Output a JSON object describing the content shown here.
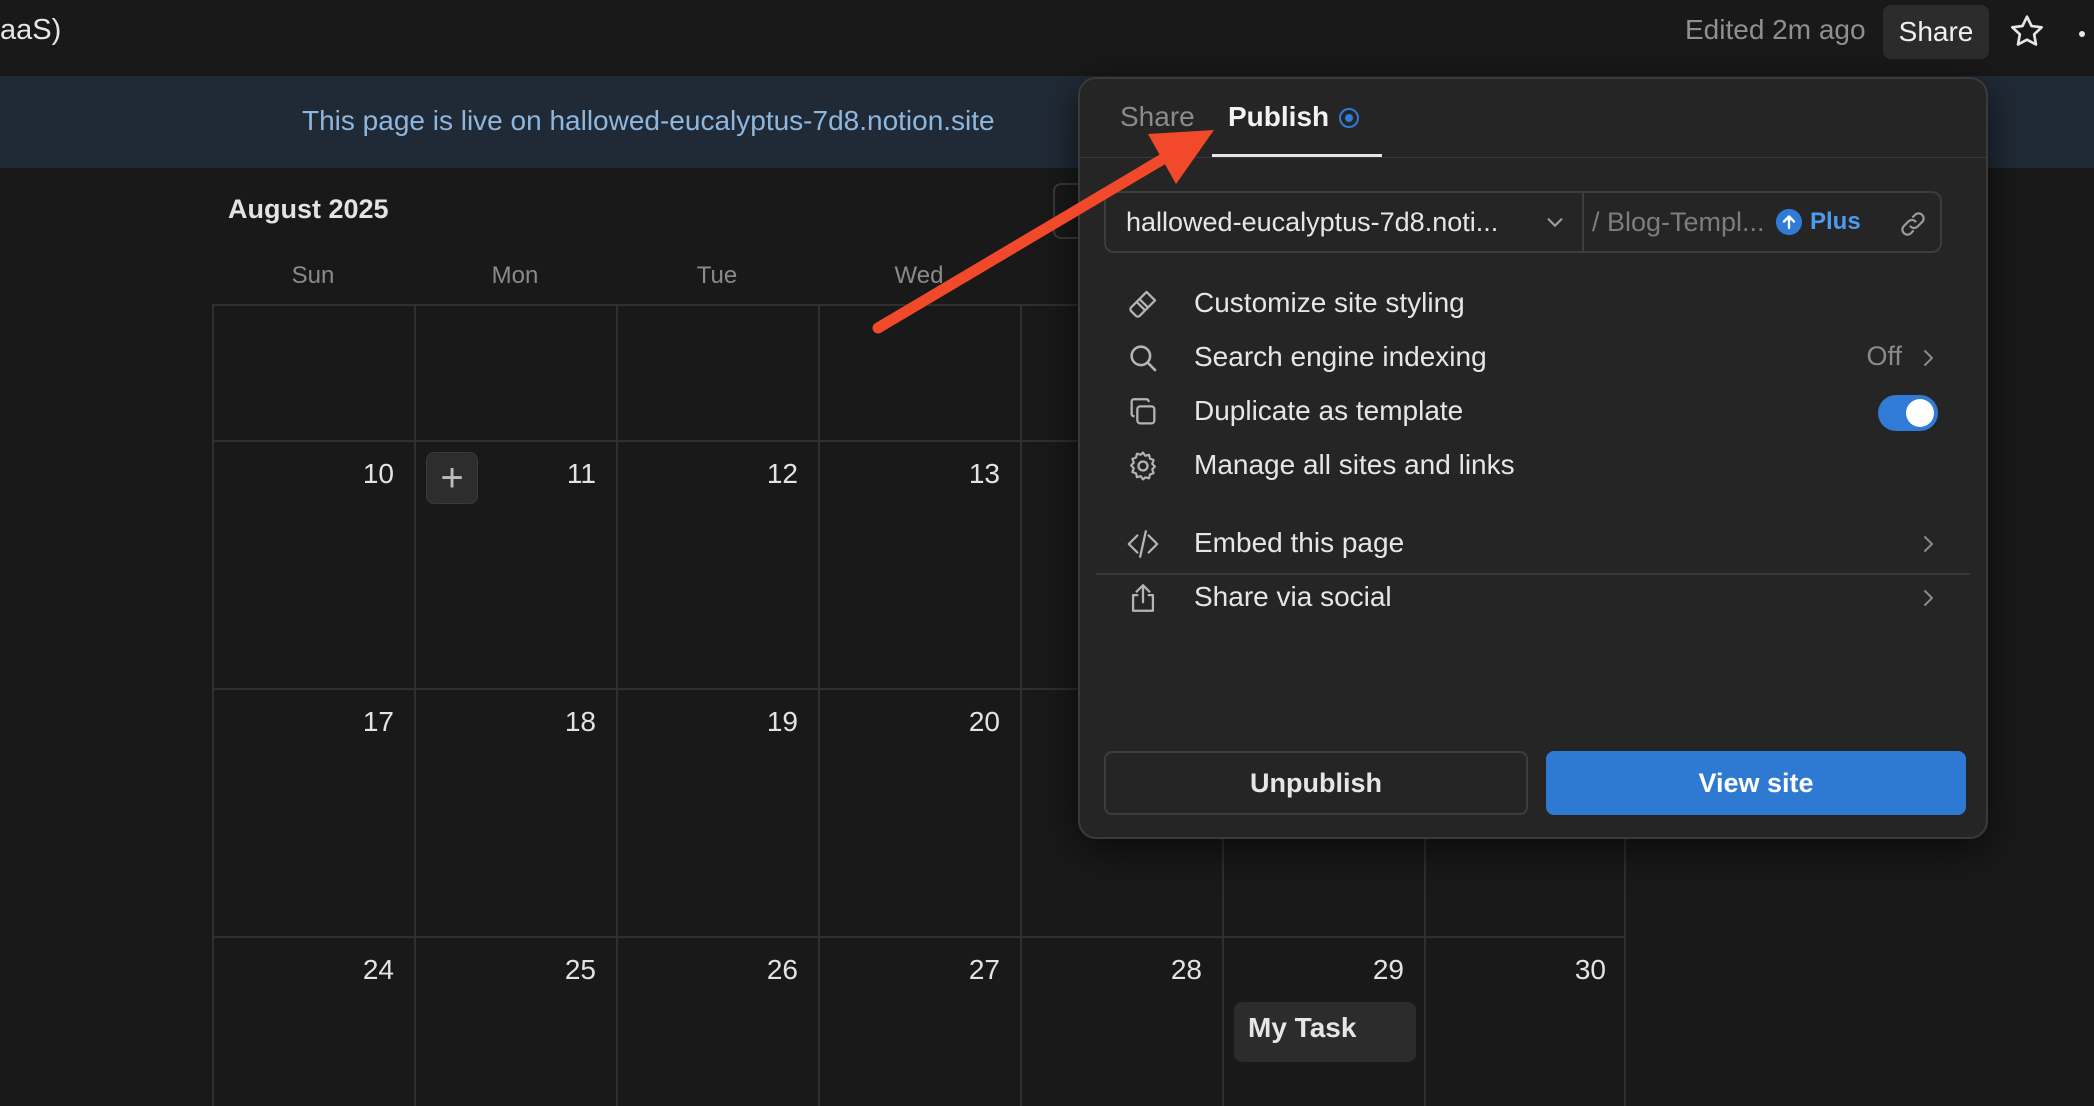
{
  "topbar": {
    "page_title": "aaS)",
    "edited_label": "Edited 2m ago",
    "share_label": "Share",
    "star_icon": "star-icon",
    "more_icon": "more-horizontal-icon"
  },
  "banner": {
    "text": "This page is live on hallowed-eucalyptus-7d8.notion.site"
  },
  "calendar": {
    "month": "August 2025",
    "weekdays": [
      "Sun",
      "Mon",
      "Tue",
      "Wed"
    ],
    "weeks": [
      [
        "",
        "",
        "",
        "",
        "",
        "",
        ""
      ],
      [
        "10",
        "11",
        "12",
        "13",
        "",
        "",
        ""
      ],
      [
        "17",
        "18",
        "19",
        "20",
        "",
        "",
        ""
      ],
      [
        "24",
        "25",
        "26",
        "27",
        "28",
        "29",
        "30"
      ]
    ],
    "add_icon": "plus-icon",
    "task_label": "My Task"
  },
  "popover": {
    "tabs": {
      "share": "Share",
      "publish": "Publish"
    },
    "url": {
      "domain": "hallowed-eucalyptus-7d8.noti...",
      "path": "/ Blog-Templ...",
      "plus_label": "Plus"
    },
    "items": {
      "customize": {
        "label": "Customize site styling",
        "icon": "paintbrush-icon"
      },
      "search": {
        "label": "Search engine indexing",
        "value": "Off",
        "icon": "search-icon"
      },
      "duplicate": {
        "label": "Duplicate as template",
        "icon": "duplicate-icon",
        "enabled": true
      },
      "manage": {
        "label": "Manage all sites and links",
        "icon": "gear-icon"
      },
      "embed": {
        "label": "Embed this page",
        "icon": "code-icon"
      },
      "social": {
        "label": "Share via social",
        "icon": "share-upload-icon"
      }
    },
    "buttons": {
      "unpublish": "Unpublish",
      "view_site": "View site"
    },
    "colors": {
      "accent": "#2e7ad3",
      "arrow": "#f2492a"
    }
  }
}
